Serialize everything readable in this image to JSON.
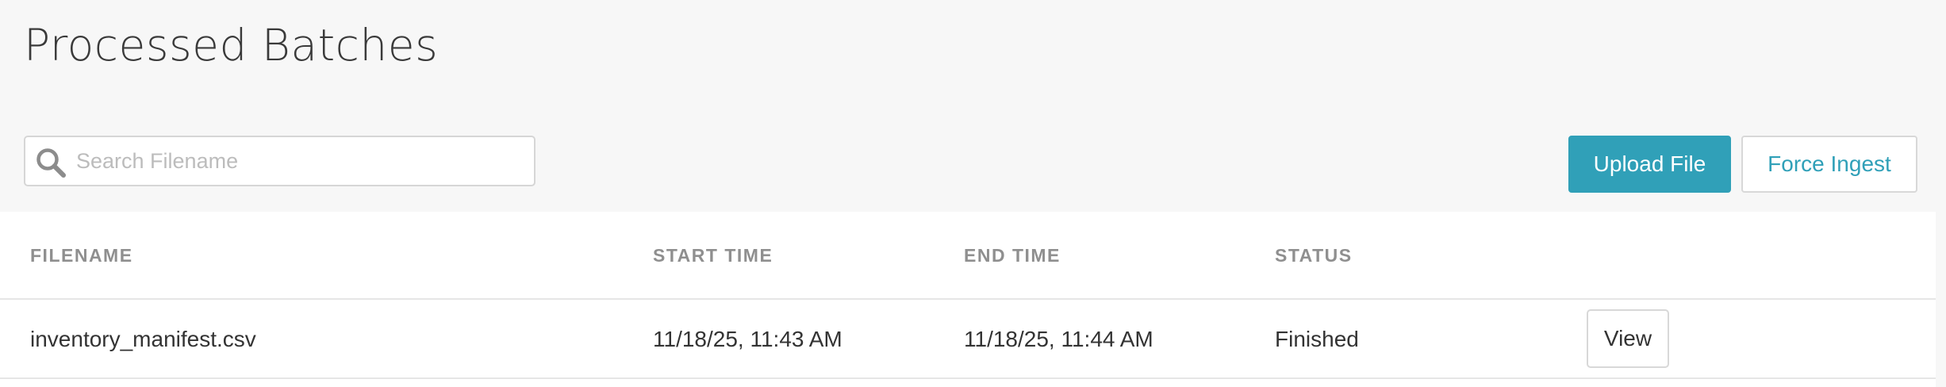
{
  "page": {
    "title": "Processed Batches"
  },
  "search": {
    "placeholder": "Search Filename",
    "value": "",
    "icon": "search-icon"
  },
  "actions": {
    "upload_label": "Upload File",
    "force_ingest_label": "Force Ingest"
  },
  "table": {
    "columns": [
      "FILENAME",
      "START TIME",
      "END TIME",
      "STATUS"
    ],
    "rows": [
      {
        "filename": "inventory_manifest.csv",
        "start_time": "11/18/25, 11:43 AM",
        "end_time": "11/18/25, 11:44 AM",
        "status": "Finished",
        "action_label": "View"
      }
    ]
  },
  "colors": {
    "accent": "#30a0b8",
    "background": "#f7f7f7",
    "panel": "#ffffff",
    "header_text": "#8f8f8f",
    "body_text": "#333333"
  }
}
